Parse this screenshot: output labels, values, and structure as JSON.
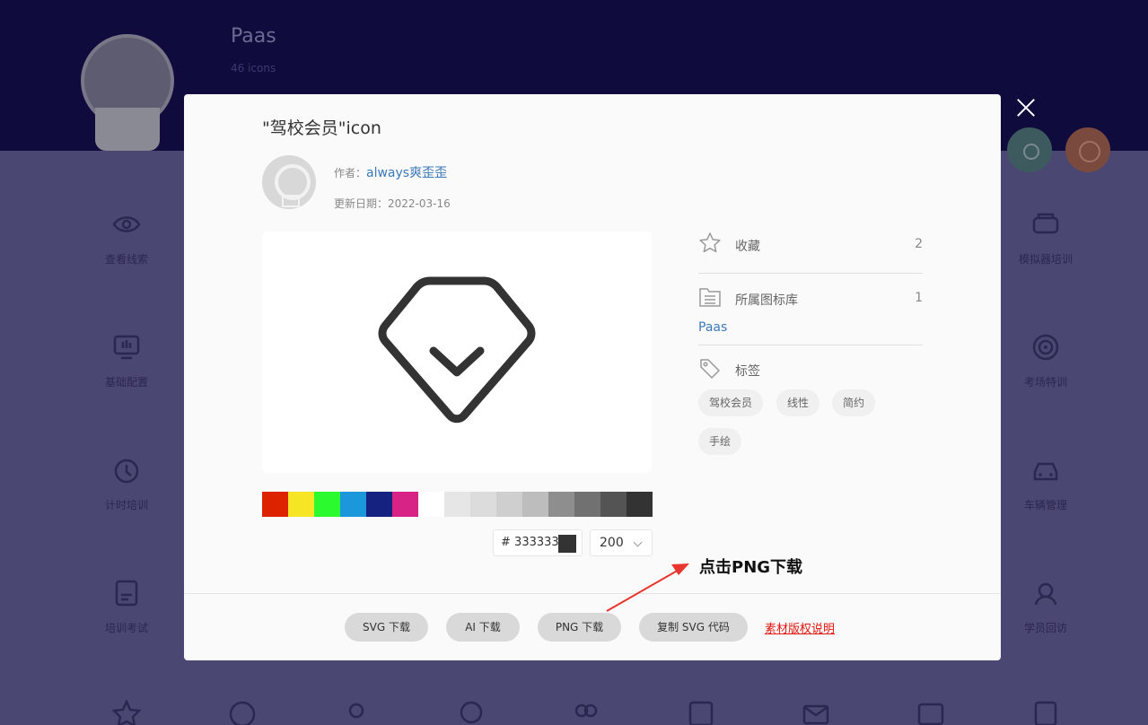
{
  "background": {
    "collection_title": "Paas",
    "icon_count": "46 icons",
    "icons": [
      {
        "label": "查看线索",
        "icon": "eye-icon"
      },
      {
        "label": "基础配置",
        "icon": "monitor-settings-icon"
      },
      {
        "label": "计时培训",
        "icon": "clock-icon"
      },
      {
        "label": "培训考试",
        "icon": "exam-paper-icon"
      },
      {
        "label": "模拟器培训",
        "icon": "vr-headset-icon"
      },
      {
        "label": "考场特训",
        "icon": "target-icon"
      },
      {
        "label": "车辆管理",
        "icon": "car-icon"
      },
      {
        "label": "学员回访",
        "icon": "headset-user-icon"
      }
    ]
  },
  "modal": {
    "title": "\"驾校会员\"icon",
    "author_label": "作者：",
    "author_name": "always爽歪歪",
    "date_label": "更新日期：",
    "date": "2022-03-16",
    "palette_colors": [
      "#dd2200",
      "#f5e524",
      "#2bfa2f",
      "#1b97db",
      "#15227f",
      "#d72385",
      "#ffffff",
      "#e6e6e6",
      "#dcdcdc",
      "#cfcfcf",
      "#bdbdbd",
      "#8e8e8e",
      "#717171",
      "#545454",
      "#333333"
    ],
    "hex_prefix": "#",
    "hex_value": "333333",
    "size_value": "200",
    "favorites_label": "收藏",
    "favorites_count": "2",
    "library_label": "所属图标库",
    "library_count": "1",
    "library_name": "Paas",
    "tags_label": "标签",
    "tags": [
      "驾校会员",
      "线性",
      "简约",
      "手绘"
    ],
    "buttons": {
      "svg": "SVG 下载",
      "ai": "AI 下载",
      "png": "PNG 下载",
      "copy": "复制 SVG 代码"
    },
    "copyright_link": "素材版权说明"
  },
  "annotation": "点击PNG下载"
}
